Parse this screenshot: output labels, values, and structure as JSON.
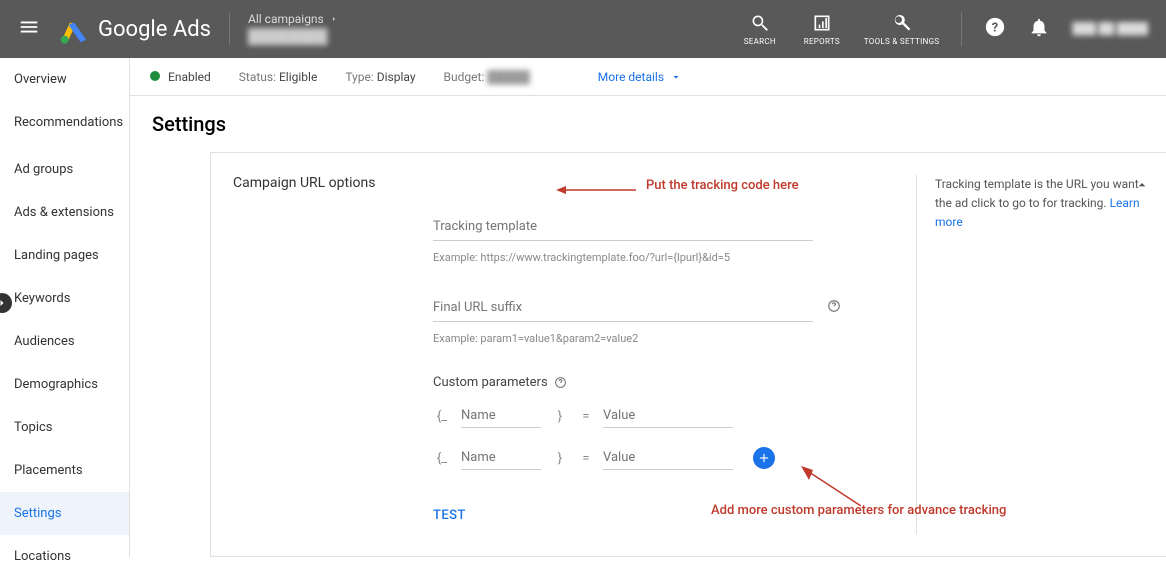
{
  "header": {
    "logo_text": "Google Ads",
    "breadcrumb_top": "All campaigns",
    "breadcrumb_bottom": "████████",
    "tools": {
      "search": "SEARCH",
      "reports": "REPORTS",
      "tools_settings": "TOOLS & SETTINGS"
    },
    "account": "███ ██ ████"
  },
  "sidebar": {
    "items": [
      "Overview",
      "Recommendations",
      "Ad groups",
      "Ads & extensions",
      "Landing pages",
      "Keywords",
      "Audiences",
      "Demographics",
      "Topics",
      "Placements",
      "Settings",
      "Locations"
    ],
    "selected_index": 10
  },
  "status_bar": {
    "state_label": "Enabled",
    "status_label": "Status:",
    "status_value": "Eligible",
    "type_label": "Type:",
    "type_value": "Display",
    "budget_label": "Budget:",
    "budget_value": "█████",
    "more_details": "More details"
  },
  "page": {
    "title": "Settings",
    "section_title": "Campaign URL options",
    "tracking_template_label": "Tracking template",
    "tracking_example": "Example: https://www.trackingtemplate.foo/?url={lpurl}&id=5",
    "final_suffix_label": "Final URL suffix",
    "final_suffix_example": "Example: param1=value1&param2=value2",
    "custom_params_label": "Custom parameters",
    "param_brace_open": "{_",
    "param_brace_close": "}",
    "param_eq": "=",
    "param_name_placeholder": "Name",
    "param_value_placeholder": "Value",
    "test_button": "TEST",
    "help_text": "Tracking template is the URL you want the ad click to go to for tracking.",
    "learn_more": "Learn more"
  },
  "annotations": {
    "a1": "Put the tracking code here",
    "a2": "Add more custom parameters for advance tracking"
  }
}
